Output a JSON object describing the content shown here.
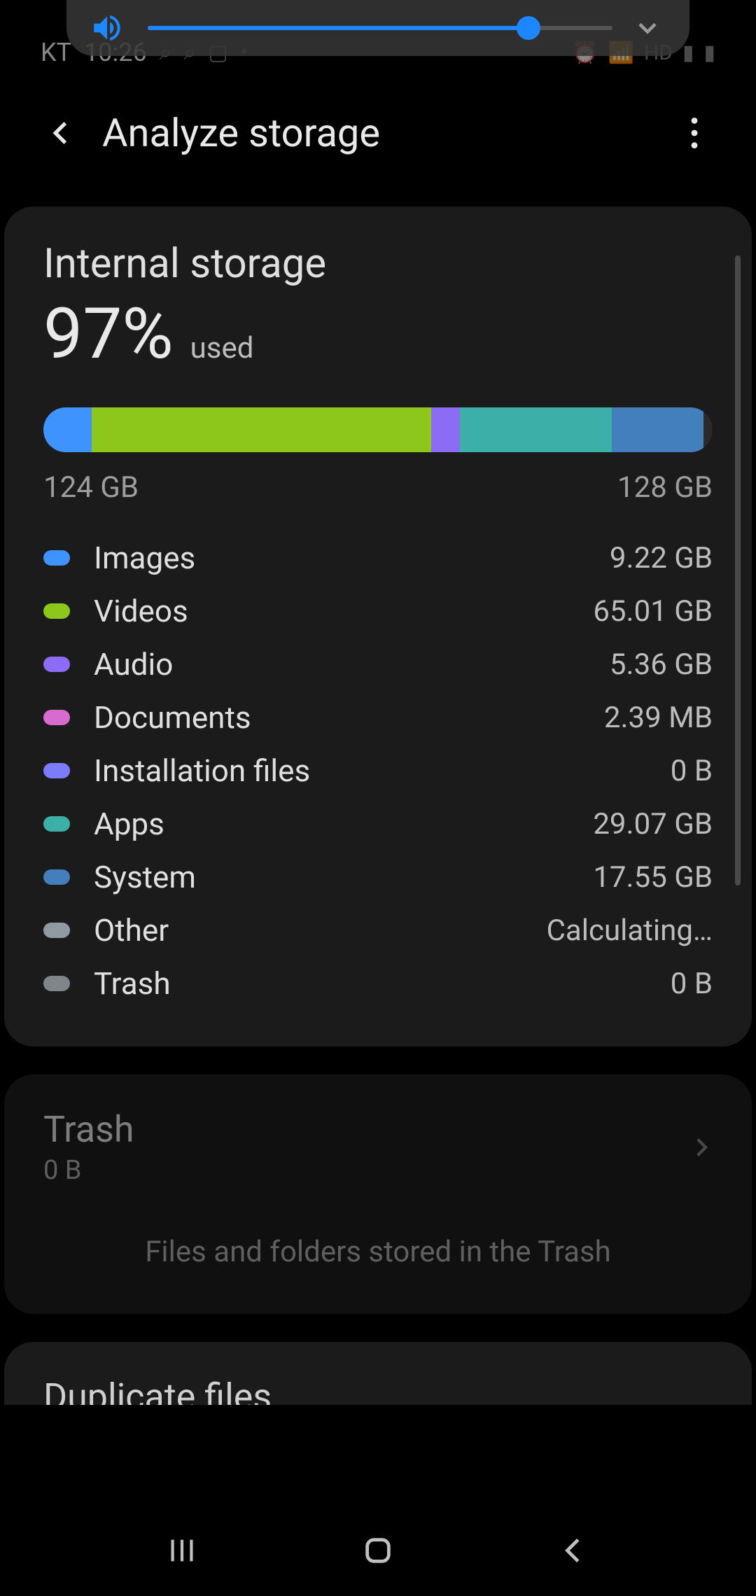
{
  "status": {
    "carrier": "KT",
    "time": "10:26"
  },
  "volume": {
    "percent": 82
  },
  "header": {
    "title": "Analyze storage"
  },
  "storage": {
    "title": "Internal storage",
    "percent": "97%",
    "used_label": "used",
    "used_amount": "124 GB",
    "total_amount": "128 GB",
    "categories": [
      {
        "key": "images",
        "label": "Images",
        "size": "9.22 GB",
        "color": "#3f93ff",
        "bar_pct": 7.2
      },
      {
        "key": "videos",
        "label": "Videos",
        "size": "65.01 GB",
        "color": "#8ec71c",
        "bar_pct": 50.8
      },
      {
        "key": "audio",
        "label": "Audio",
        "size": "5.36 GB",
        "color": "#8c6cf5",
        "bar_pct": 4.2
      },
      {
        "key": "documents",
        "label": "Documents",
        "size": "2.39 MB",
        "color": "#d86bd0",
        "bar_pct": 0.0
      },
      {
        "key": "install",
        "label": "Installation files",
        "size": "0 B",
        "color": "#7c7cfa",
        "bar_pct": 0.0
      },
      {
        "key": "apps",
        "label": "Apps",
        "size": "29.07 GB",
        "color": "#3cb0a8",
        "bar_pct": 22.7
      },
      {
        "key": "system",
        "label": "System",
        "size": "17.55 GB",
        "color": "#437ebd",
        "bar_pct": 13.7
      },
      {
        "key": "other",
        "label": "Other",
        "size": "Calculating…",
        "color": "#8f9aa3",
        "bar_pct": 0.0
      },
      {
        "key": "trash",
        "label": "Trash",
        "size": "0 B",
        "color": "#7e868c",
        "bar_pct": 0.0
      }
    ]
  },
  "trash_card": {
    "title": "Trash",
    "size": "0 B",
    "description": "Files and folders stored in the Trash"
  },
  "peek_card": {
    "title": "Duplicate files"
  }
}
